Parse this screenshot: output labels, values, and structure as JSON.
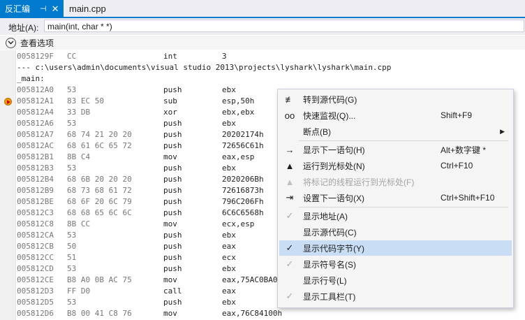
{
  "tabs": {
    "active_label": "反汇编",
    "pin_icon": "⊣",
    "close_icon": "✕",
    "file_label": "main.cpp"
  },
  "address": {
    "label": "地址(A):",
    "value": "main(int, char * *)"
  },
  "view_options": {
    "label": "查看选项"
  },
  "code_lines": [
    {
      "addr": "0058129F",
      "bytes": "CC",
      "op": "int",
      "arg": "3"
    },
    {
      "source": "--- c:\\users\\admin\\documents\\visual studio 2013\\projects\\lyshark\\lyshark\\main.cpp"
    },
    {
      "source": "_main:"
    },
    {
      "addr": "005812A0",
      "bytes": "53",
      "op": "push",
      "arg": "ebx"
    },
    {
      "addr": "005812A1",
      "bytes": "83 EC 50",
      "op": "sub",
      "arg": "esp,50h"
    },
    {
      "addr": "005812A4",
      "bytes": "33 DB",
      "op": "xor",
      "arg": "ebx,ebx"
    },
    {
      "addr": "005812A6",
      "bytes": "53",
      "op": "push",
      "arg": "ebx"
    },
    {
      "addr": "005812A7",
      "bytes": "68 74 21 20 20",
      "op": "push",
      "arg": "20202174h"
    },
    {
      "addr": "005812AC",
      "bytes": "68 61 6C 65 72",
      "op": "push",
      "arg": "72656C61h"
    },
    {
      "addr": "005812B1",
      "bytes": "8B C4",
      "op": "mov",
      "arg": "eax,esp"
    },
    {
      "addr": "005812B3",
      "bytes": "53",
      "op": "push",
      "arg": "ebx"
    },
    {
      "addr": "005812B4",
      "bytes": "68 6B 20 20 20",
      "op": "push",
      "arg": "2020206Bh"
    },
    {
      "addr": "005812B9",
      "bytes": "68 73 68 61 72",
      "op": "push",
      "arg": "72616873h"
    },
    {
      "addr": "005812BE",
      "bytes": "68 6F 20 6C 79",
      "op": "push",
      "arg": "796C206Fh"
    },
    {
      "addr": "005812C3",
      "bytes": "68 68 65 6C 6C",
      "op": "push",
      "arg": "6C6C6568h"
    },
    {
      "addr": "005812C8",
      "bytes": "8B CC",
      "op": "mov",
      "arg": "ecx,esp"
    },
    {
      "addr": "005812CA",
      "bytes": "53",
      "op": "push",
      "arg": "ebx"
    },
    {
      "addr": "005812CB",
      "bytes": "50",
      "op": "push",
      "arg": "eax"
    },
    {
      "addr": "005812CC",
      "bytes": "51",
      "op": "push",
      "arg": "ecx"
    },
    {
      "addr": "005812CD",
      "bytes": "53",
      "op": "push",
      "arg": "ebx"
    },
    {
      "addr": "005812CE",
      "bytes": "B8 A0 0B AC 75",
      "op": "mov",
      "arg": "eax,75AC0BA0"
    },
    {
      "addr": "005812D3",
      "bytes": "FF D0",
      "op": "call",
      "arg": "eax"
    },
    {
      "addr": "005812D5",
      "bytes": "53",
      "op": "push",
      "arg": "ebx"
    },
    {
      "addr": "005812D6",
      "bytes": "B8 00 41 C8 76",
      "op": "mov",
      "arg": "eax,76C84100h"
    }
  ],
  "menu": [
    {
      "label": "转到源代码(G)",
      "shortcut": "",
      "icon": "goto-source-icon",
      "glyph": "≢"
    },
    {
      "label": "快速监视(Q)...",
      "shortcut": "Shift+F9",
      "icon": "quickwatch-icon",
      "glyph": "oo"
    },
    {
      "label": "断点(B)",
      "shortcut": "",
      "icon": "",
      "glyph": "",
      "submenu": true
    },
    {
      "label": "显示下一语句(H)",
      "shortcut": "Alt+数字键 *",
      "icon": "next-statement-icon",
      "glyph": "→"
    },
    {
      "label": "运行到光标处(N)",
      "shortcut": "Ctrl+F10",
      "icon": "run-to-cursor-icon",
      "glyph": "▲"
    },
    {
      "label": "将标记的线程运行到光标处(F)",
      "shortcut": "",
      "icon": "run-flagged-threads-icon",
      "glyph": "▲",
      "disabled": true
    },
    {
      "label": "设置下一语句(X)",
      "shortcut": "Ctrl+Shift+F10",
      "icon": "set-next-statement-icon",
      "glyph": "⇥"
    },
    {
      "label": "显示地址(A)",
      "shortcut": "",
      "icon": "check-icon",
      "glyph": "✓",
      "gray": true
    },
    {
      "label": "显示源代码(C)",
      "shortcut": "",
      "icon": "",
      "glyph": ""
    },
    {
      "label": "显示代码字节(Y)",
      "shortcut": "",
      "icon": "check-icon",
      "glyph": "✓",
      "highlight": true
    },
    {
      "label": "显示符号名(S)",
      "shortcut": "",
      "icon": "check-icon",
      "glyph": "✓",
      "gray": true
    },
    {
      "label": "显示行号(L)",
      "shortcut": "",
      "icon": "",
      "glyph": ""
    },
    {
      "label": "显示工具栏(T)",
      "shortcut": "",
      "icon": "check-icon",
      "glyph": "✓",
      "gray": true
    }
  ],
  "colors": {
    "accent": "#007acc",
    "menu_highlight": "#c9def5",
    "ip_marker": "#f0a000"
  }
}
